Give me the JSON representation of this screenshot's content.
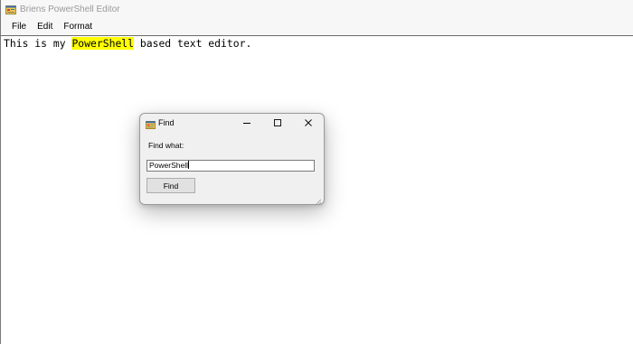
{
  "window": {
    "title": "Briens PowerShell Editor",
    "icon": "form-icon"
  },
  "menu": {
    "items": [
      {
        "label": "File"
      },
      {
        "label": "Edit"
      },
      {
        "label": "Format"
      }
    ]
  },
  "editor": {
    "before": "This is my ",
    "highlighted": "PowerShell",
    "after": " based text editor.",
    "highlight_color": "#ffff00"
  },
  "find_dialog": {
    "title": "Find",
    "icon": "form-icon",
    "controls": {
      "minimize": "minimize-icon",
      "maximize": "maximize-icon",
      "close": "close-icon"
    },
    "label": "Find what:",
    "input_value": "PowerShell",
    "button_label": "Find"
  }
}
